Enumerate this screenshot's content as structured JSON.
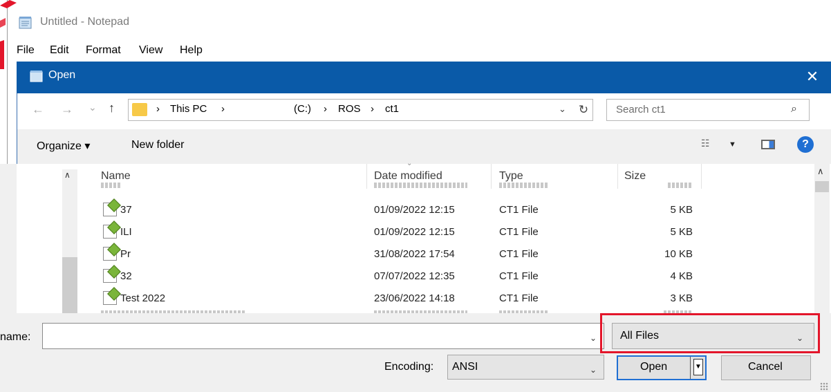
{
  "notepad": {
    "title": "Untitled - Notepad",
    "menu": [
      "File",
      "Edit",
      "Format",
      "View",
      "Help"
    ]
  },
  "dialog": {
    "title": "Open",
    "close_glyph": "✕",
    "nav": {
      "back": "←",
      "forward": "→",
      "recent": "⌄",
      "up": "↑"
    },
    "breadcrumbs": [
      "This PC",
      "(C:)",
      "ROS",
      "ct1"
    ],
    "crumb_sep": "›",
    "search_placeholder": "Search ct1",
    "toolbar": {
      "organize": "Organize ▾",
      "new_folder": "New folder"
    },
    "columns": {
      "name": "Name",
      "date": "Date modified",
      "type": "Type",
      "size": "Size"
    },
    "files": [
      {
        "name": "37",
        "date": "01/09/2022 12:15",
        "type": "CT1 File",
        "size": "5 KB"
      },
      {
        "name": "ILI",
        "date": "01/09/2022 12:15",
        "type": "CT1 File",
        "size": "5 KB"
      },
      {
        "name": "Pr",
        "date": "31/08/2022 17:54",
        "type": "CT1 File",
        "size": "10 KB"
      },
      {
        "name": "32",
        "date": "07/07/2022 12:35",
        "type": "CT1 File",
        "size": "4 KB"
      },
      {
        "name": "Test 2022",
        "date": "23/06/2022 14:18",
        "type": "CT1 File",
        "size": "3 KB"
      }
    ],
    "filename_label": "name:",
    "filename_value": "",
    "file_type": "All Files",
    "encoding_label": "Encoding:",
    "encoding_value": "ANSI",
    "open_label": "Open",
    "cancel_label": "Cancel"
  },
  "colors": {
    "title_bar": "#0a5aa8",
    "highlight": "#e3162b",
    "primary_border": "#1f6fd3"
  }
}
